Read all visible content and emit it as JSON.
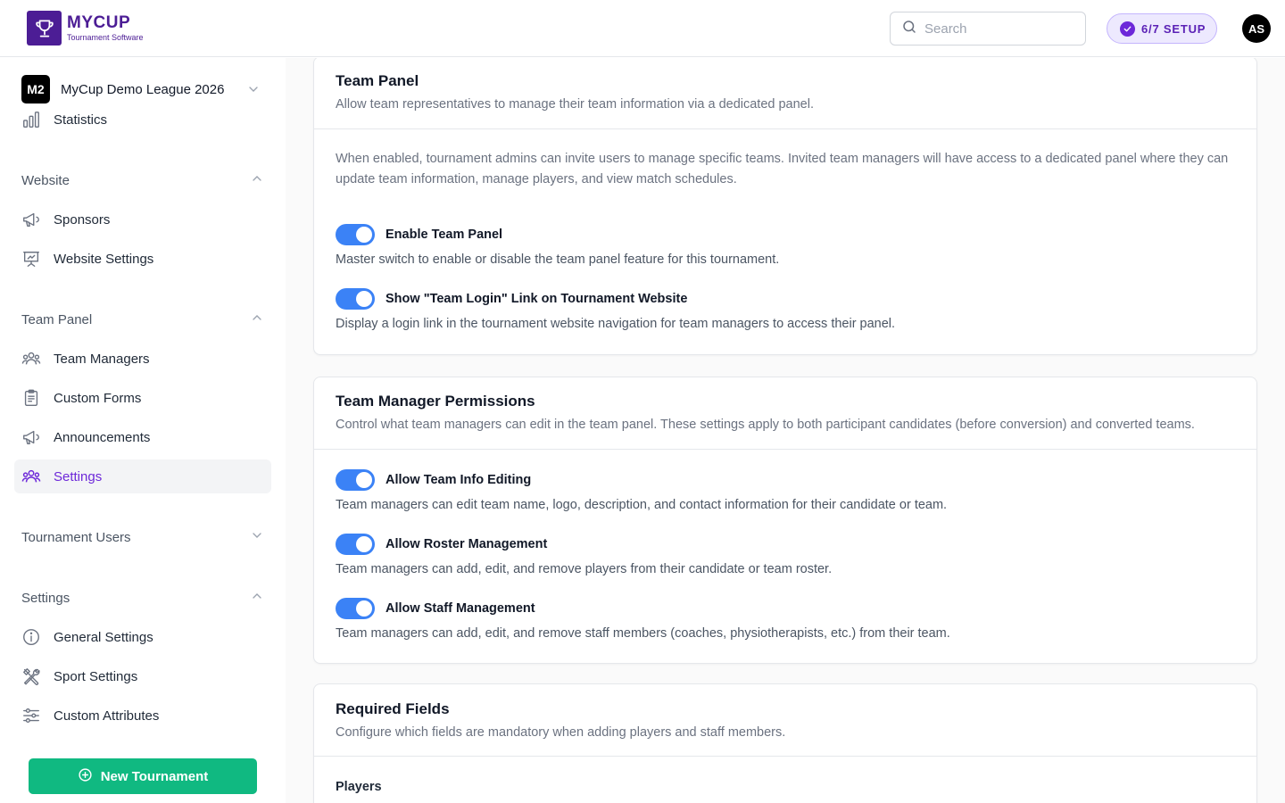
{
  "brand": {
    "name": "MYCUP",
    "tagline": "Tournament Software",
    "accent": "#4c1d95"
  },
  "header": {
    "search_placeholder": "Search",
    "setup_progress": "6/7 SETUP",
    "user_initials": "AS"
  },
  "sidebar": {
    "league": {
      "badge": "M2",
      "name": "MyCup Demo League 2026"
    },
    "top_items": [
      {
        "label": "Statistics",
        "icon": "bar-chart-icon"
      }
    ],
    "sections": [
      {
        "label": "Website",
        "expanded": true,
        "items": [
          {
            "label": "Sponsors",
            "icon": "megaphone-icon"
          },
          {
            "label": "Website Settings",
            "icon": "presentation-icon"
          }
        ]
      },
      {
        "label": "Team Panel",
        "expanded": true,
        "items": [
          {
            "label": "Team Managers",
            "icon": "users-icon"
          },
          {
            "label": "Custom Forms",
            "icon": "clipboard-icon"
          },
          {
            "label": "Announcements",
            "icon": "megaphone-icon"
          },
          {
            "label": "Settings",
            "icon": "users-icon",
            "active": true
          }
        ]
      },
      {
        "label": "Tournament Users",
        "expanded": false,
        "items": []
      },
      {
        "label": "Settings",
        "expanded": true,
        "items": [
          {
            "label": "General Settings",
            "icon": "info-icon"
          },
          {
            "label": "Sport Settings",
            "icon": "tools-icon"
          },
          {
            "label": "Custom Attributes",
            "icon": "sliders-icon"
          }
        ]
      }
    ],
    "new_tournament_label": "New Tournament",
    "new_tournament_color": "#10b981",
    "active_color": "#6d28d9"
  },
  "main": {
    "team_panel": {
      "title": "Team Panel",
      "description": "Allow team representatives to manage their team information via a dedicated panel.",
      "intro": "When enabled, tournament admins can invite users to manage specific teams. Invited team managers will have access to a dedicated panel where they can update team information, manage players, and view match schedules.",
      "toggles": [
        {
          "label": "Enable Team Panel",
          "description": "Master switch to enable or disable the team panel feature for this tournament.",
          "on": true
        },
        {
          "label": "Show \"Team Login\" Link on Tournament Website",
          "description": "Display a login link in the tournament website navigation for team managers to access their panel.",
          "on": true
        }
      ]
    },
    "permissions": {
      "title": "Team Manager Permissions",
      "description": "Control what team managers can edit in the team panel. These settings apply to both participant candidates (before conversion) and converted teams.",
      "toggles": [
        {
          "label": "Allow Team Info Editing",
          "description": "Team managers can edit team name, logo, description, and contact information for their candidate or team.",
          "on": true
        },
        {
          "label": "Allow Roster Management",
          "description": "Team managers can add, edit, and remove players from their candidate or team roster.",
          "on": true
        },
        {
          "label": "Allow Staff Management",
          "description": "Team managers can add, edit, and remove staff members (coaches, physiotherapists, etc.) from their team.",
          "on": true
        }
      ]
    },
    "required_fields": {
      "title": "Required Fields",
      "description": "Configure which fields are mandatory when adding players and staff members.",
      "players_label": "Players"
    },
    "toggle_color": "#3b82f6"
  }
}
